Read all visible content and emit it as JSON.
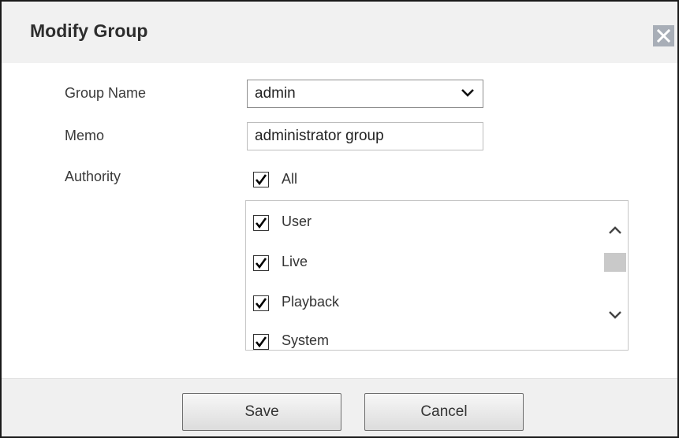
{
  "dialog": {
    "title": "Modify Group",
    "close_icon": "close-icon"
  },
  "form": {
    "group_name_label": "Group Name",
    "group_name_value": "admin",
    "memo_label": "Memo",
    "memo_value": "administrator group",
    "authority_label": "Authority",
    "all_label": "All",
    "all_checked": true
  },
  "authority_list": [
    {
      "label": "User",
      "checked": true
    },
    {
      "label": "Live",
      "checked": true
    },
    {
      "label": "Playback",
      "checked": true
    },
    {
      "label": "System",
      "checked": true
    }
  ],
  "buttons": {
    "save": "Save",
    "cancel": "Cancel"
  },
  "colors": {
    "title_bar": "#f1f1f1",
    "content_bg": "#ffffff",
    "close_button": "#a8aeb7"
  }
}
